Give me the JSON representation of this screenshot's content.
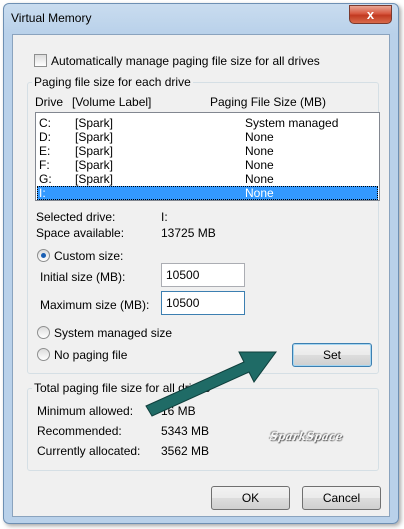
{
  "window": {
    "title": "Virtual Memory",
    "close_glyph": "x"
  },
  "auto_manage": {
    "label": "Automatically manage paging file size for all drives",
    "checked": false
  },
  "drives_group": {
    "title": "Paging file size for each drive",
    "headers": {
      "drive": "Drive",
      "volume": "[Volume Label]",
      "size": "Paging File Size (MB)"
    },
    "rows": [
      {
        "drive": "C:",
        "volume": "[Spark]",
        "size": "System managed"
      },
      {
        "drive": "D:",
        "volume": "[Spark]",
        "size": "None"
      },
      {
        "drive": "E:",
        "volume": "[Spark]",
        "size": "None"
      },
      {
        "drive": "F:",
        "volume": "[Spark]",
        "size": "None"
      },
      {
        "drive": "G:",
        "volume": "[Spark]",
        "size": "None"
      },
      {
        "drive": "I:",
        "volume": "",
        "size": "None",
        "selected": true
      }
    ],
    "selected_drive_label": "Selected drive:",
    "selected_drive_value": "I:",
    "space_available_label": "Space available:",
    "space_available_value": "13725 MB",
    "custom_size_label": "Custom size:",
    "initial_size_label": "Initial size (MB):",
    "initial_size_value": "10500",
    "maximum_size_label": "Maximum size (MB):",
    "maximum_size_value": "10500",
    "system_managed_label": "System managed size",
    "no_paging_label": "No paging file",
    "set_button": "Set"
  },
  "totals_group": {
    "title": "Total paging file size for all drives",
    "minimum_label": "Minimum allowed:",
    "minimum_value": "16 MB",
    "recommended_label": "Recommended:",
    "recommended_value": "5343 MB",
    "currently_label": "Currently allocated:",
    "currently_value": "3562 MB"
  },
  "watermark": "SparkSpace",
  "buttons": {
    "ok": "OK",
    "cancel": "Cancel"
  },
  "colors": {
    "selection": "#3399ff",
    "arrow": "#1f6b66",
    "title_bar": "#b9d1ea"
  }
}
